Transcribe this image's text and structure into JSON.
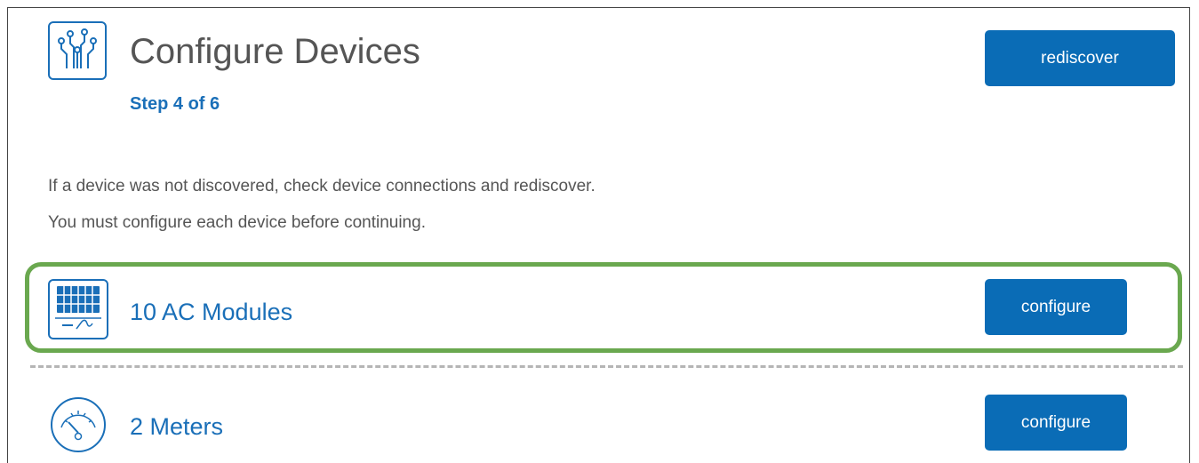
{
  "header": {
    "title": "Configure Devices",
    "step": "Step 4 of 6",
    "icon": "circuit-icon",
    "rediscover_label": "rediscover"
  },
  "instructions": {
    "line1": "If a device was not discovered, check device connections and rediscover.",
    "line2": "You must configure each device before continuing."
  },
  "devices": [
    {
      "name": "10 AC Modules",
      "icon": "solar-module-icon",
      "button_label": "configure",
      "highlighted": true
    },
    {
      "name": "2 Meters",
      "icon": "meter-icon",
      "button_label": "configure",
      "highlighted": false
    }
  ],
  "colors": {
    "accent": "#0a6cb6",
    "link_blue": "#1a6fb8",
    "highlight_green": "#6aa84f",
    "text_gray": "#555555",
    "divider_gray": "#b5b5b5"
  }
}
